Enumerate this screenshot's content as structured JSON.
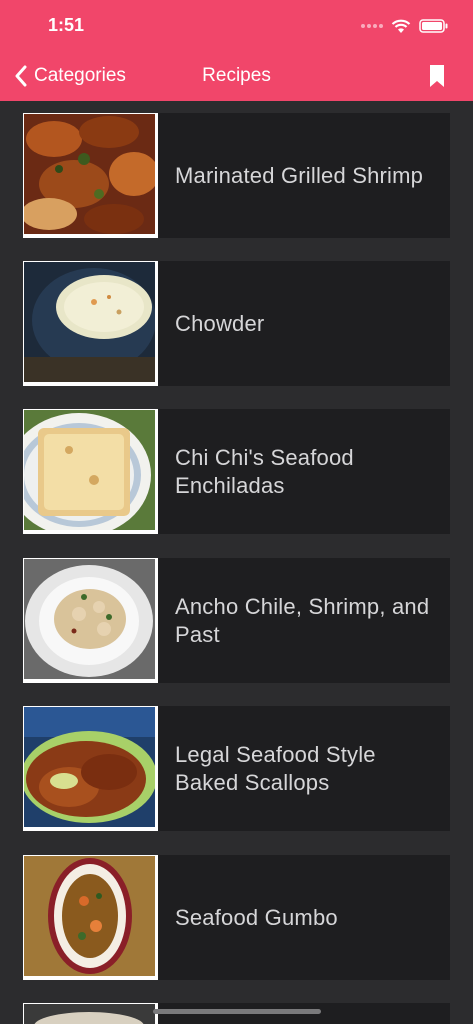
{
  "status_bar": {
    "time": "1:51"
  },
  "nav": {
    "back_label": "Categories",
    "title": "Recipes"
  },
  "recipes": [
    {
      "title": "Marinated Grilled Shrimp"
    },
    {
      "title": "Chowder"
    },
    {
      "title": "Chi Chi's Seafood Enchiladas"
    },
    {
      "title": "Ancho Chile, Shrimp, and Past"
    },
    {
      "title": "Legal Seafood Style Baked Scallops"
    },
    {
      "title": "Seafood Gumbo"
    }
  ],
  "colors": {
    "accent": "#f1466a",
    "background": "#2c2c2e",
    "card": "#1e1e20",
    "text": "#d6d6d8"
  }
}
